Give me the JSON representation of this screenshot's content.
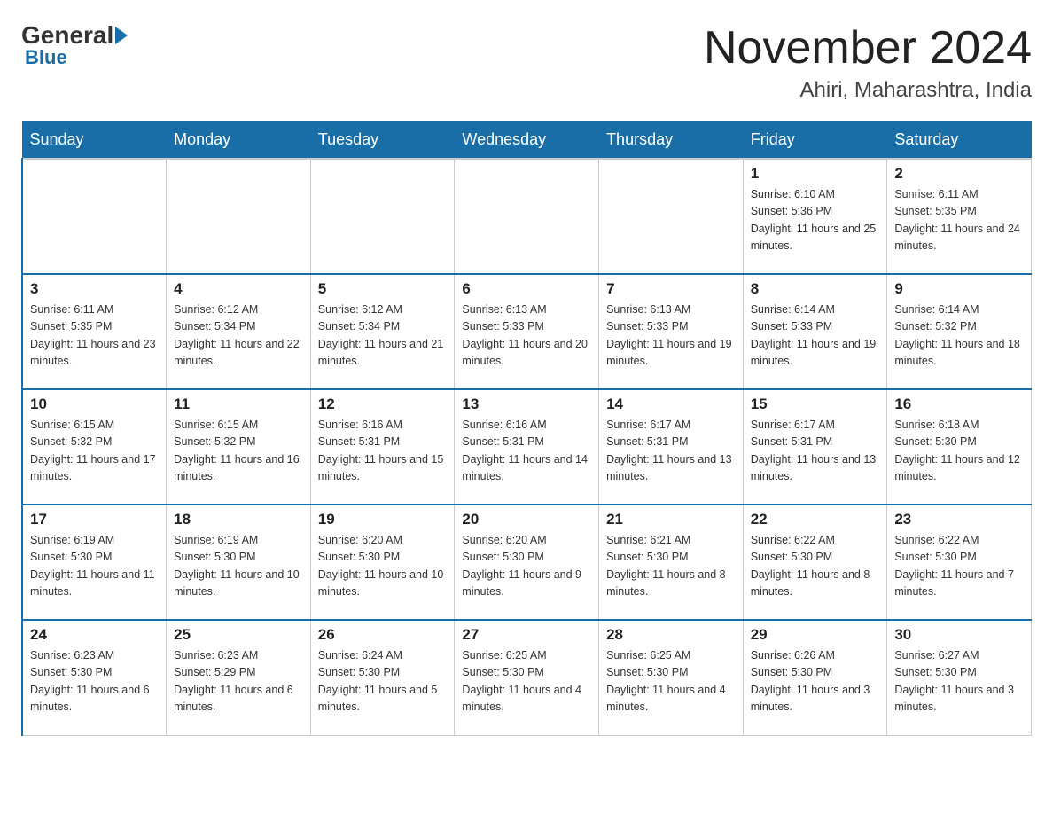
{
  "header": {
    "logo": {
      "general": "General",
      "blue": "Blue"
    },
    "title": "November 2024",
    "location": "Ahiri, Maharashtra, India"
  },
  "days_of_week": [
    "Sunday",
    "Monday",
    "Tuesday",
    "Wednesday",
    "Thursday",
    "Friday",
    "Saturday"
  ],
  "weeks": [
    [
      {
        "day": "",
        "info": ""
      },
      {
        "day": "",
        "info": ""
      },
      {
        "day": "",
        "info": ""
      },
      {
        "day": "",
        "info": ""
      },
      {
        "day": "",
        "info": ""
      },
      {
        "day": "1",
        "info": "Sunrise: 6:10 AM\nSunset: 5:36 PM\nDaylight: 11 hours and 25 minutes."
      },
      {
        "day": "2",
        "info": "Sunrise: 6:11 AM\nSunset: 5:35 PM\nDaylight: 11 hours and 24 minutes."
      }
    ],
    [
      {
        "day": "3",
        "info": "Sunrise: 6:11 AM\nSunset: 5:35 PM\nDaylight: 11 hours and 23 minutes."
      },
      {
        "day": "4",
        "info": "Sunrise: 6:12 AM\nSunset: 5:34 PM\nDaylight: 11 hours and 22 minutes."
      },
      {
        "day": "5",
        "info": "Sunrise: 6:12 AM\nSunset: 5:34 PM\nDaylight: 11 hours and 21 minutes."
      },
      {
        "day": "6",
        "info": "Sunrise: 6:13 AM\nSunset: 5:33 PM\nDaylight: 11 hours and 20 minutes."
      },
      {
        "day": "7",
        "info": "Sunrise: 6:13 AM\nSunset: 5:33 PM\nDaylight: 11 hours and 19 minutes."
      },
      {
        "day": "8",
        "info": "Sunrise: 6:14 AM\nSunset: 5:33 PM\nDaylight: 11 hours and 19 minutes."
      },
      {
        "day": "9",
        "info": "Sunrise: 6:14 AM\nSunset: 5:32 PM\nDaylight: 11 hours and 18 minutes."
      }
    ],
    [
      {
        "day": "10",
        "info": "Sunrise: 6:15 AM\nSunset: 5:32 PM\nDaylight: 11 hours and 17 minutes."
      },
      {
        "day": "11",
        "info": "Sunrise: 6:15 AM\nSunset: 5:32 PM\nDaylight: 11 hours and 16 minutes."
      },
      {
        "day": "12",
        "info": "Sunrise: 6:16 AM\nSunset: 5:31 PM\nDaylight: 11 hours and 15 minutes."
      },
      {
        "day": "13",
        "info": "Sunrise: 6:16 AM\nSunset: 5:31 PM\nDaylight: 11 hours and 14 minutes."
      },
      {
        "day": "14",
        "info": "Sunrise: 6:17 AM\nSunset: 5:31 PM\nDaylight: 11 hours and 13 minutes."
      },
      {
        "day": "15",
        "info": "Sunrise: 6:17 AM\nSunset: 5:31 PM\nDaylight: 11 hours and 13 minutes."
      },
      {
        "day": "16",
        "info": "Sunrise: 6:18 AM\nSunset: 5:30 PM\nDaylight: 11 hours and 12 minutes."
      }
    ],
    [
      {
        "day": "17",
        "info": "Sunrise: 6:19 AM\nSunset: 5:30 PM\nDaylight: 11 hours and 11 minutes."
      },
      {
        "day": "18",
        "info": "Sunrise: 6:19 AM\nSunset: 5:30 PM\nDaylight: 11 hours and 10 minutes."
      },
      {
        "day": "19",
        "info": "Sunrise: 6:20 AM\nSunset: 5:30 PM\nDaylight: 11 hours and 10 minutes."
      },
      {
        "day": "20",
        "info": "Sunrise: 6:20 AM\nSunset: 5:30 PM\nDaylight: 11 hours and 9 minutes."
      },
      {
        "day": "21",
        "info": "Sunrise: 6:21 AM\nSunset: 5:30 PM\nDaylight: 11 hours and 8 minutes."
      },
      {
        "day": "22",
        "info": "Sunrise: 6:22 AM\nSunset: 5:30 PM\nDaylight: 11 hours and 8 minutes."
      },
      {
        "day": "23",
        "info": "Sunrise: 6:22 AM\nSunset: 5:30 PM\nDaylight: 11 hours and 7 minutes."
      }
    ],
    [
      {
        "day": "24",
        "info": "Sunrise: 6:23 AM\nSunset: 5:30 PM\nDaylight: 11 hours and 6 minutes."
      },
      {
        "day": "25",
        "info": "Sunrise: 6:23 AM\nSunset: 5:29 PM\nDaylight: 11 hours and 6 minutes."
      },
      {
        "day": "26",
        "info": "Sunrise: 6:24 AM\nSunset: 5:30 PM\nDaylight: 11 hours and 5 minutes."
      },
      {
        "day": "27",
        "info": "Sunrise: 6:25 AM\nSunset: 5:30 PM\nDaylight: 11 hours and 4 minutes."
      },
      {
        "day": "28",
        "info": "Sunrise: 6:25 AM\nSunset: 5:30 PM\nDaylight: 11 hours and 4 minutes."
      },
      {
        "day": "29",
        "info": "Sunrise: 6:26 AM\nSunset: 5:30 PM\nDaylight: 11 hours and 3 minutes."
      },
      {
        "day": "30",
        "info": "Sunrise: 6:27 AM\nSunset: 5:30 PM\nDaylight: 11 hours and 3 minutes."
      }
    ]
  ]
}
